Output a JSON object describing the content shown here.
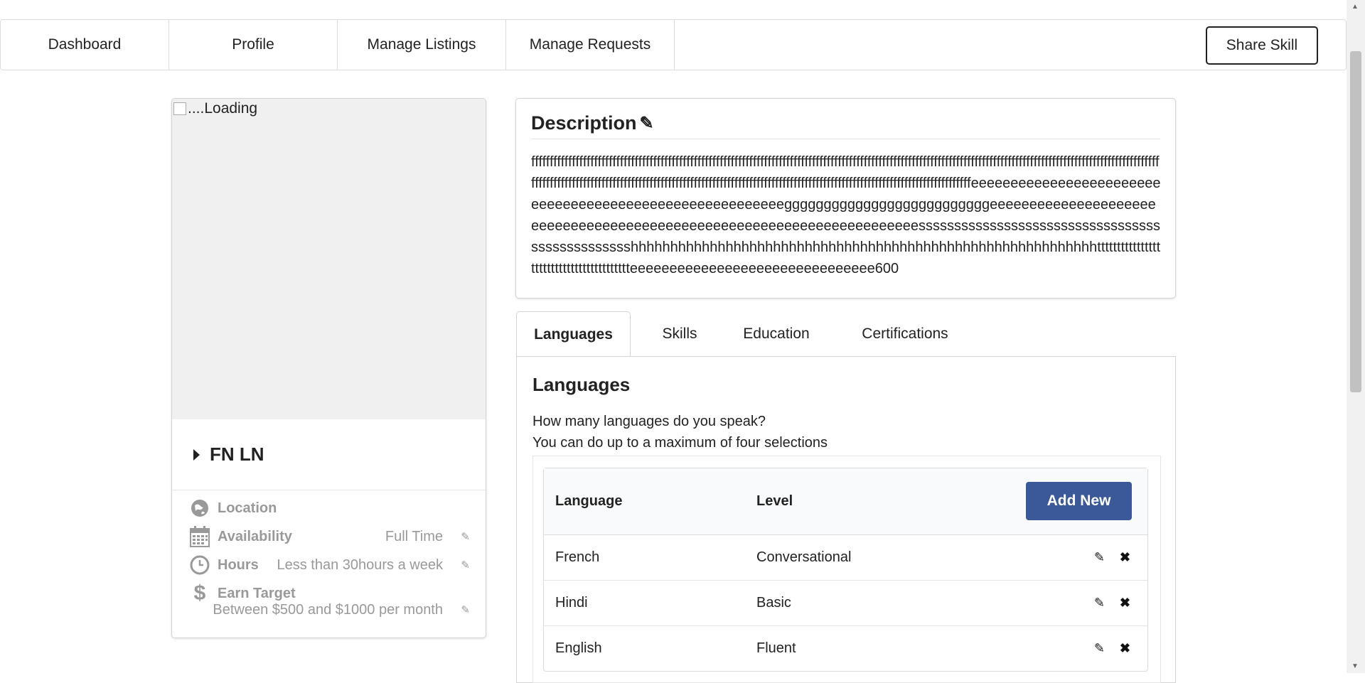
{
  "nav": {
    "items": [
      "Dashboard",
      "Profile",
      "Manage Listings",
      "Manage Requests"
    ],
    "share_button": "Share Skill"
  },
  "profile": {
    "photo_alt": "....Loading",
    "name": "FN LN",
    "location_label": "Location",
    "availability_label": "Availability",
    "availability_value": "Full Time",
    "hours_label": "Hours",
    "hours_value": "Less than 30hours a week",
    "earn_label": "Earn Target",
    "earn_value": "Between $500 and $1000 per month"
  },
  "description": {
    "title": "Description",
    "text": "fffffffffffffffffffffffffffffffffffffffffffffffffffffffffffffffffffffffffffffffffffffffffffffffffffffffffffffffffffffffffffffffffffffffffffffffffffffffffffffffffffffffffffffffffffffffffffffffffffffffffffffffffffffffffffffffffffffffffffffffffffffffffffffffffffffffffffffffffffffffffffffffffeeeeeeeeeeeeeeeeeeeeeeeeeeeeeeeeeeeeeeeeeeeeeeeeeeeeeeeeggggggggggggggggggggggggggeeeeeeeeeeeeeeeeeeeeeeeeeeeeeeeeeeeeeeeeeeeeeeeeeeeeeeeeeeeeeeeeeeeeeesssssssssssssssssssssssssssssssssssssssssssssssshhhhhhhhhhhhhhhhhhhhhhhhhhhhhhhhhhhhhhhhhhhhhhhhhhhhhhhhhhhttttttttttttttttttttttttttttttttttttttttteeeeeeeeeeeeeeeeeeeeeeeeeeeeeee600"
  },
  "tabs": [
    "Languages",
    "Skills",
    "Education",
    "Certifications"
  ],
  "languages": {
    "title": "Languages",
    "question": "How many languages do you speak?",
    "hint": "You can do up to a maximum of four selections",
    "col_language": "Language",
    "col_level": "Level",
    "add_button": "Add New",
    "rows": [
      {
        "language": "French",
        "level": "Conversational"
      },
      {
        "language": "Hindi",
        "level": "Basic"
      },
      {
        "language": "English",
        "level": "Fluent"
      }
    ]
  },
  "icons": [
    "globe-icon",
    "calendar-icon",
    "clock-icon",
    "dollar-icon",
    "pencil-icon",
    "close-icon",
    "caret-right-icon"
  ]
}
